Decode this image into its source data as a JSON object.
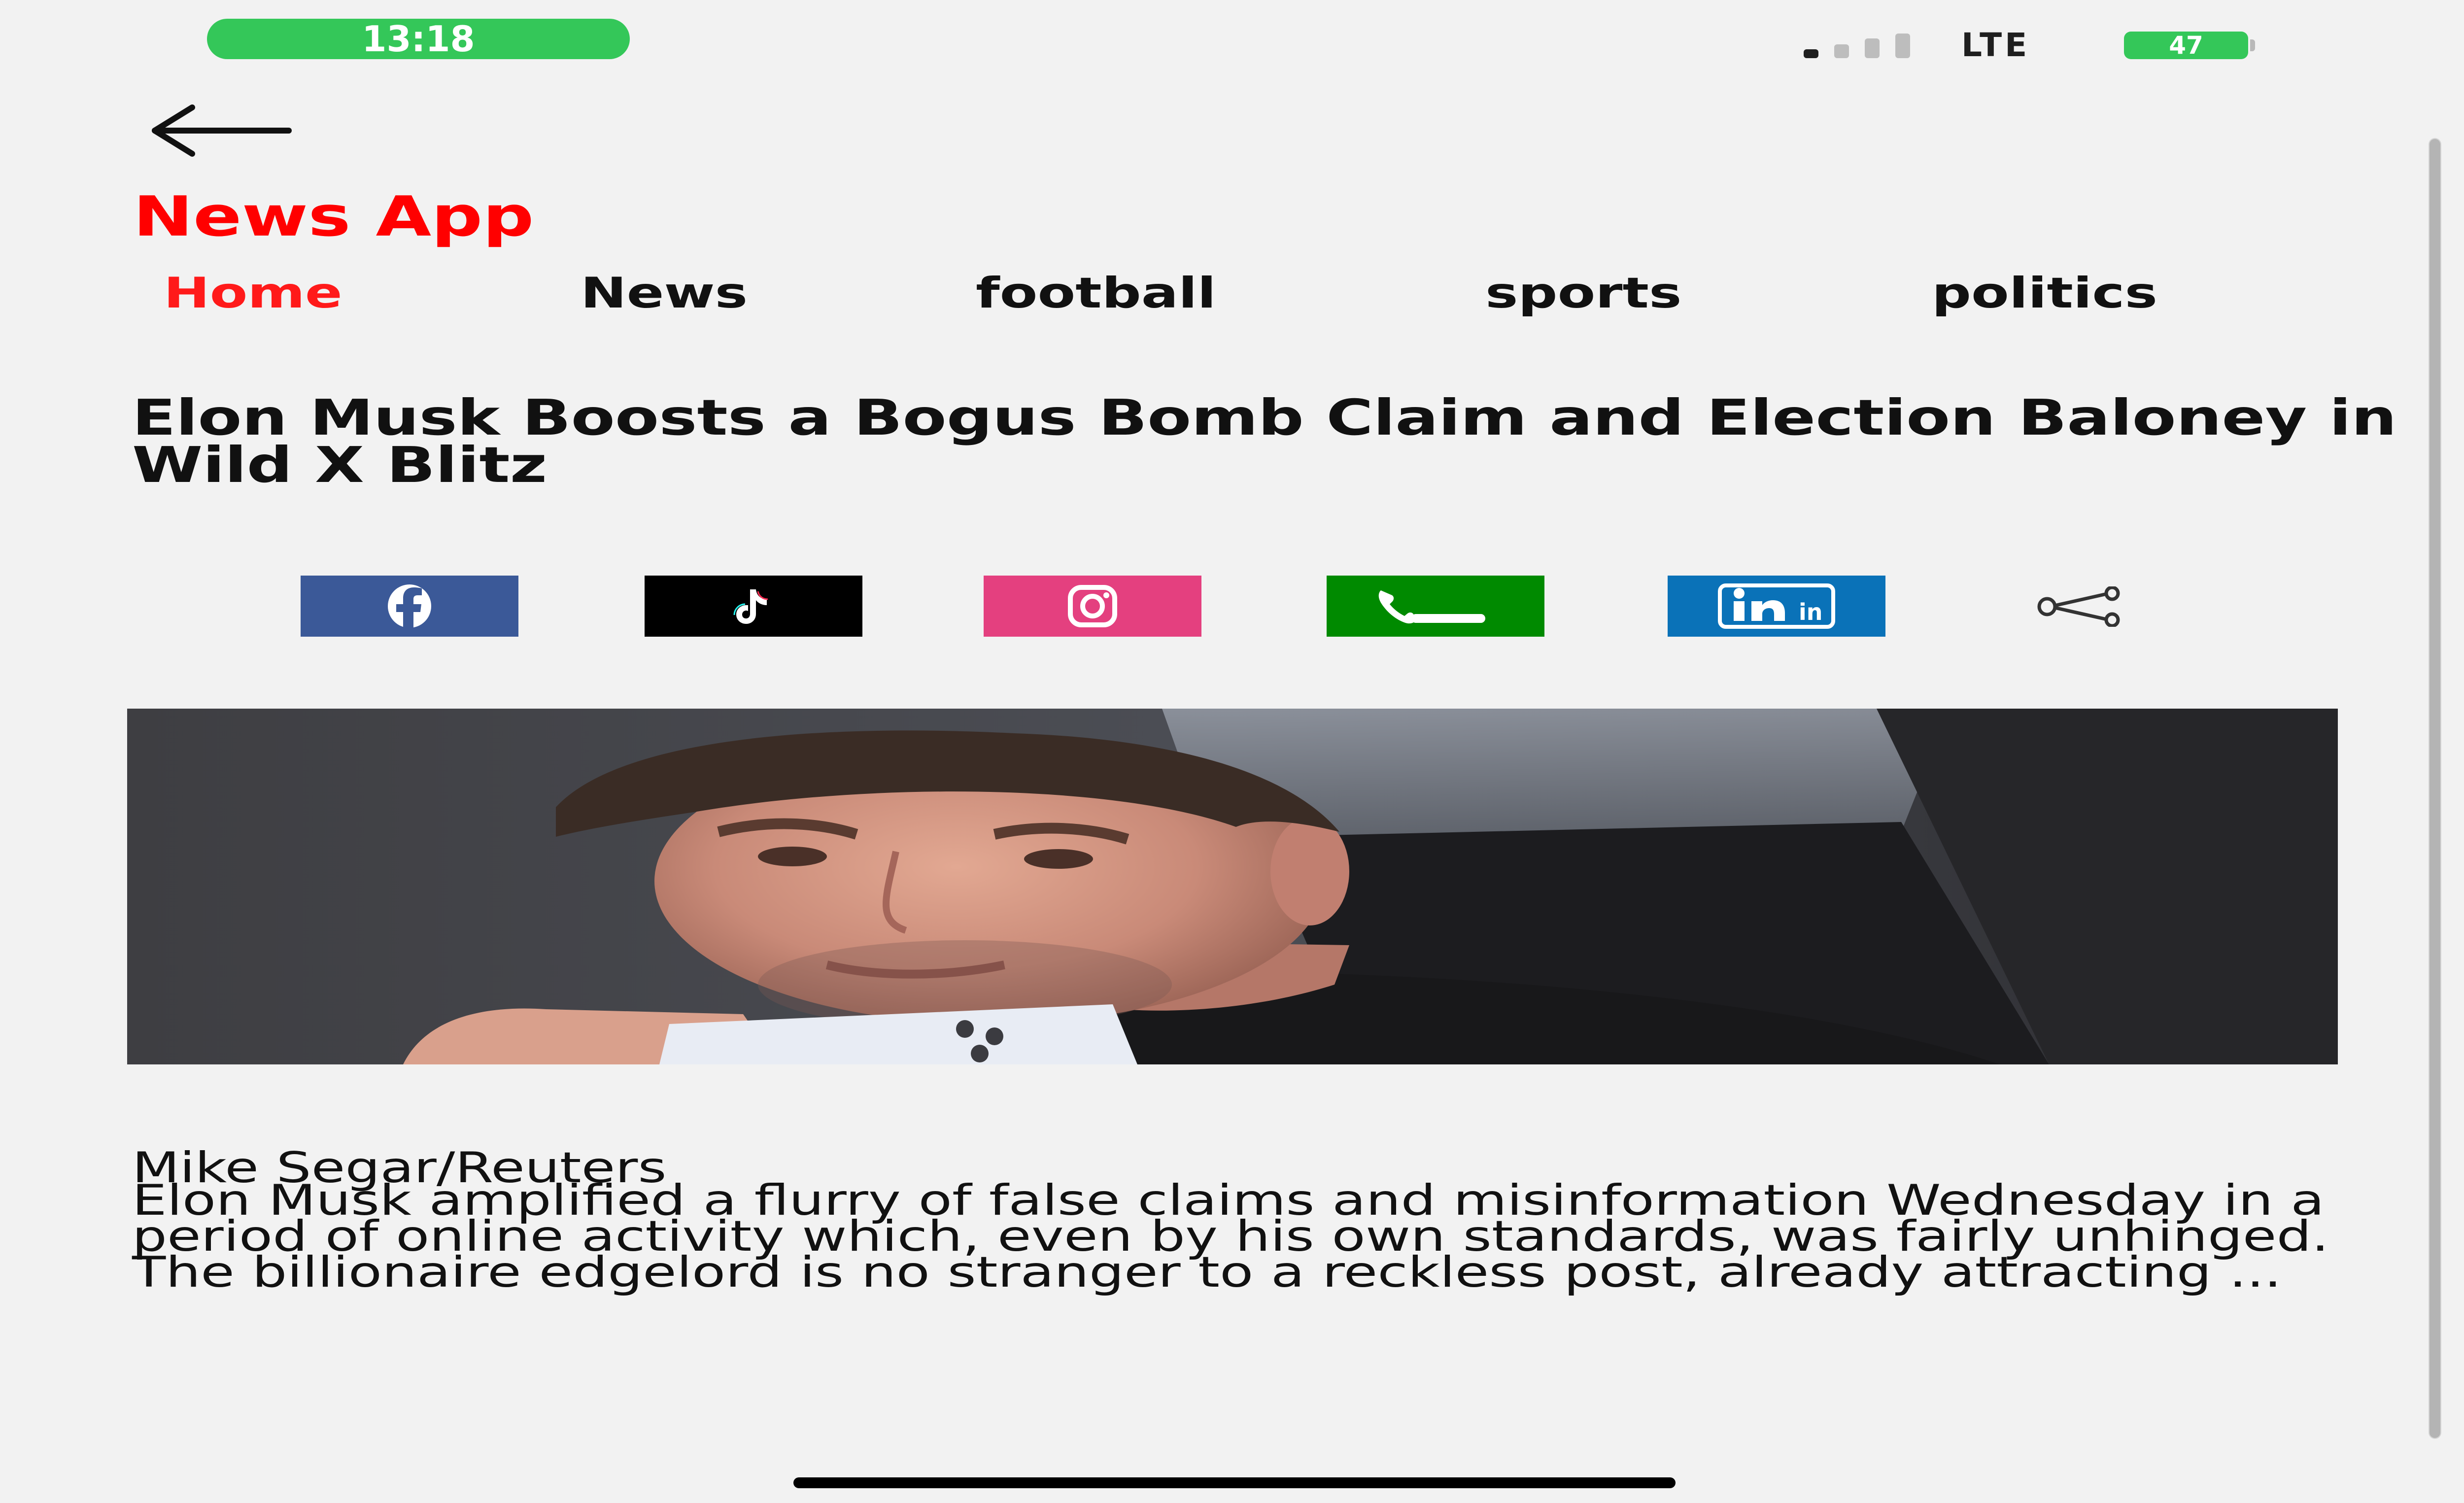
{
  "status_bar": {
    "time": "13:18",
    "network": "LTE",
    "battery": "47",
    "signal_bars_active": 1,
    "signal_bars_total": 4
  },
  "app": {
    "title": "News App",
    "accent_color": "#ff0000"
  },
  "nav": {
    "tabs": [
      {
        "label": "Home",
        "active": true
      },
      {
        "label": "News",
        "active": false
      },
      {
        "label": "football",
        "active": false
      },
      {
        "label": "sports",
        "active": false
      },
      {
        "label": "politics",
        "active": false
      }
    ]
  },
  "article": {
    "headline": "Elon Musk Boosts a Bogus Bomb Claim and Election Baloney in Wild X Blitz",
    "image_alt": "Elon Musk holding a phone",
    "photo_credit": "Mike Segar/Reuters",
    "body": "Elon Musk amplified a flurry of false claims and misinformation Wednesday in a period of online activity which, even by his own standards, was fairly unhinged. The billionaire edgelord is no stranger to a reckless post, already attracting ..."
  },
  "share_bar": {
    "buttons": [
      {
        "name": "facebook",
        "icon": "facebook-icon",
        "color": "#3b5998"
      },
      {
        "name": "tiktok",
        "icon": "tiktok-icon",
        "color": "#000000"
      },
      {
        "name": "instagram",
        "icon": "instagram-icon",
        "color": "#e4407f"
      },
      {
        "name": "phone",
        "icon": "phone-icon",
        "color": "#008a00"
      },
      {
        "name": "linkedin",
        "icon": "linkedin-icon",
        "color": "#0a72b8"
      }
    ],
    "more_icon": "share-icon"
  }
}
